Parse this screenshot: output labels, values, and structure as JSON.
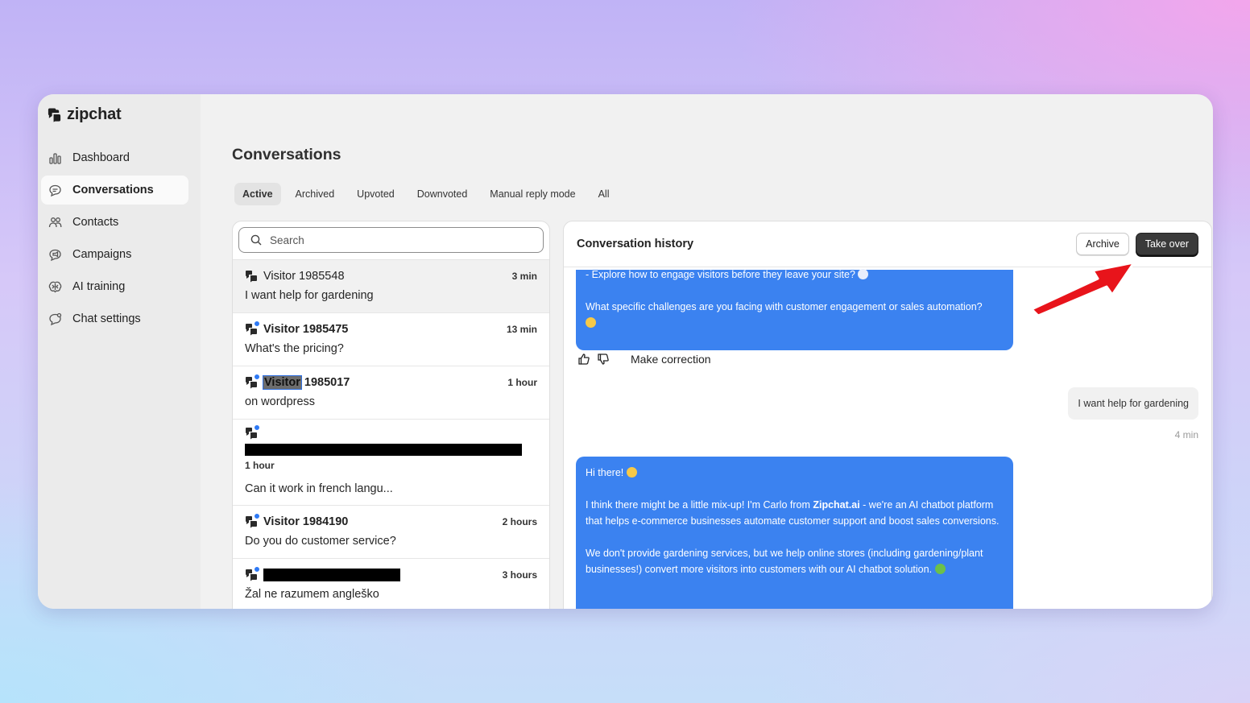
{
  "app": {
    "logo_text": "zipchat"
  },
  "sidebar": {
    "items": [
      {
        "label": "Dashboard",
        "icon": "bar-chart-icon"
      },
      {
        "label": "Conversations",
        "icon": "chat-bubble-icon",
        "active": true
      },
      {
        "label": "Contacts",
        "icon": "people-icon"
      },
      {
        "label": "Campaigns",
        "icon": "megaphone-bubble-icon"
      },
      {
        "label": "AI training",
        "icon": "brain-icon"
      },
      {
        "label": "Chat settings",
        "icon": "chat-gear-icon"
      }
    ]
  },
  "page": {
    "title": "Conversations"
  },
  "tabs": [
    "Active",
    "Archived",
    "Upvoted",
    "Downvoted",
    "Manual reply mode",
    "All"
  ],
  "search": {
    "placeholder": "Search"
  },
  "conversations": [
    {
      "name": "Visitor 1985548",
      "time": "3 min",
      "preview": "I want help for gardening"
    },
    {
      "name": "Visitor 1985475",
      "time": "13 min",
      "preview": "What's the pricing?"
    },
    {
      "name_highlight": "Visitor",
      "name_rest": " 1985017",
      "time": "1 hour",
      "preview": "on wordpress"
    },
    {
      "time": "1 hour",
      "preview": "Can it work in french langu..."
    },
    {
      "name": "Visitor 1984190",
      "time": "2 hours",
      "preview": "Do you do customer service?"
    },
    {
      "time": "3 hours",
      "preview": "Žal ne razumem angleško"
    }
  ],
  "history": {
    "title": "Conversation history",
    "archive_label": "Archive",
    "takeover_label": "Take over",
    "bubble1": {
      "line1": "- Explore how to engage visitors before they leave your site?",
      "line2": "What specific challenges are you facing with customer engagement or sales automation?"
    },
    "correction_label": "Make correction",
    "user_message": "I want help for gardening",
    "user_time": "4 min",
    "bubble2": {
      "greeting": "Hi there!",
      "p1_before": "I think there might be a little mix-up! I'm Carlo from ",
      "p1_bold": "Zipchat.ai",
      "p1_after": " - we're an AI chatbot platform that helps e-commerce businesses automate customer support and boost sales conversions.",
      "p2": "We don't provide gardening services, but we help online stores (including gardening/plant businesses!) convert more visitors into customers with our AI chatbot solution."
    }
  },
  "colors": {
    "accent": "#3b82f0",
    "unread_dot": "#2f7af5",
    "arrow": "#e8141b"
  }
}
